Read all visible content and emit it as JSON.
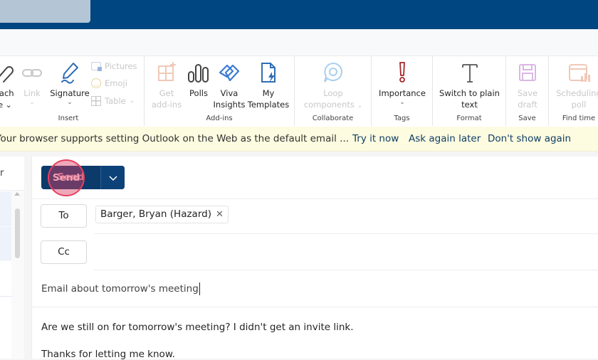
{
  "app": {
    "name": "Outlook on the Web",
    "brand_color": "#004680"
  },
  "ribbon": {
    "groups": {
      "insert": {
        "label": "Insert",
        "attach_label": "tach",
        "attach_sub": "e",
        "link_label": "Link",
        "signature_label": "Signature",
        "pictures_label": "Pictures",
        "emoji_label": "Emoji",
        "table_label": "Table"
      },
      "addins": {
        "label": "Add-ins",
        "get_addins_line1": "Get",
        "get_addins_line2": "add-ins",
        "polls_label": "Polls",
        "viva_line1": "Viva",
        "viva_line2": "Insights",
        "templates_line1": "My",
        "templates_line2": "Templates"
      },
      "collaborate": {
        "label": "Collaborate",
        "loop_line1": "Loop",
        "loop_line2": "components"
      },
      "tags": {
        "label": "Tags",
        "importance_label": "Importance"
      },
      "format": {
        "label": "Format",
        "plain_line1": "Switch to plain",
        "plain_line2": "text"
      },
      "save": {
        "label": "Save",
        "save_line1": "Save",
        "save_line2": "draft"
      },
      "findtime": {
        "label": "Find time",
        "poll_line1": "Scheduling",
        "poll_line2": "poll"
      }
    }
  },
  "notice": {
    "message": "Your browser supports setting Outlook on the Web as the default email ...",
    "try_now": "Try it now",
    "ask_later": "Ask again later",
    "dont_show": "Don't show again"
  },
  "left_pane": {
    "header_fragment": "r"
  },
  "compose": {
    "send_label": "Send",
    "to_label": "To",
    "cc_label": "Cc",
    "to_recipients": [
      {
        "name": "Barger, Bryan (Hazard)"
      }
    ],
    "subject": "Email about tomorrow's meeting",
    "body_lines": [
      "Are we still on for tomorrow's meeting? I didn't get an invite link.",
      "Thanks for letting me know."
    ]
  }
}
